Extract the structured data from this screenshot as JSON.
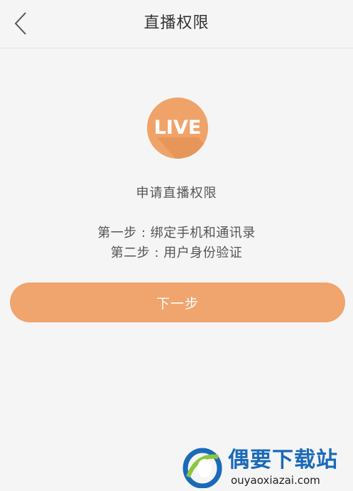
{
  "header": {
    "title": "直播权限",
    "back_icon": "chevron-left-icon"
  },
  "badge": {
    "text": "LIVE",
    "color": "#f0a369"
  },
  "content": {
    "apply_title": "申请直播权限",
    "steps": [
      "第一步 : 绑定手机和通讯录",
      "第二步 : 用户身份验证"
    ]
  },
  "action": {
    "next_label": "下一步",
    "color": "#f0a46e"
  },
  "watermark": {
    "name": "偶要下载站",
    "url": "ouyaoxiazai.com"
  }
}
